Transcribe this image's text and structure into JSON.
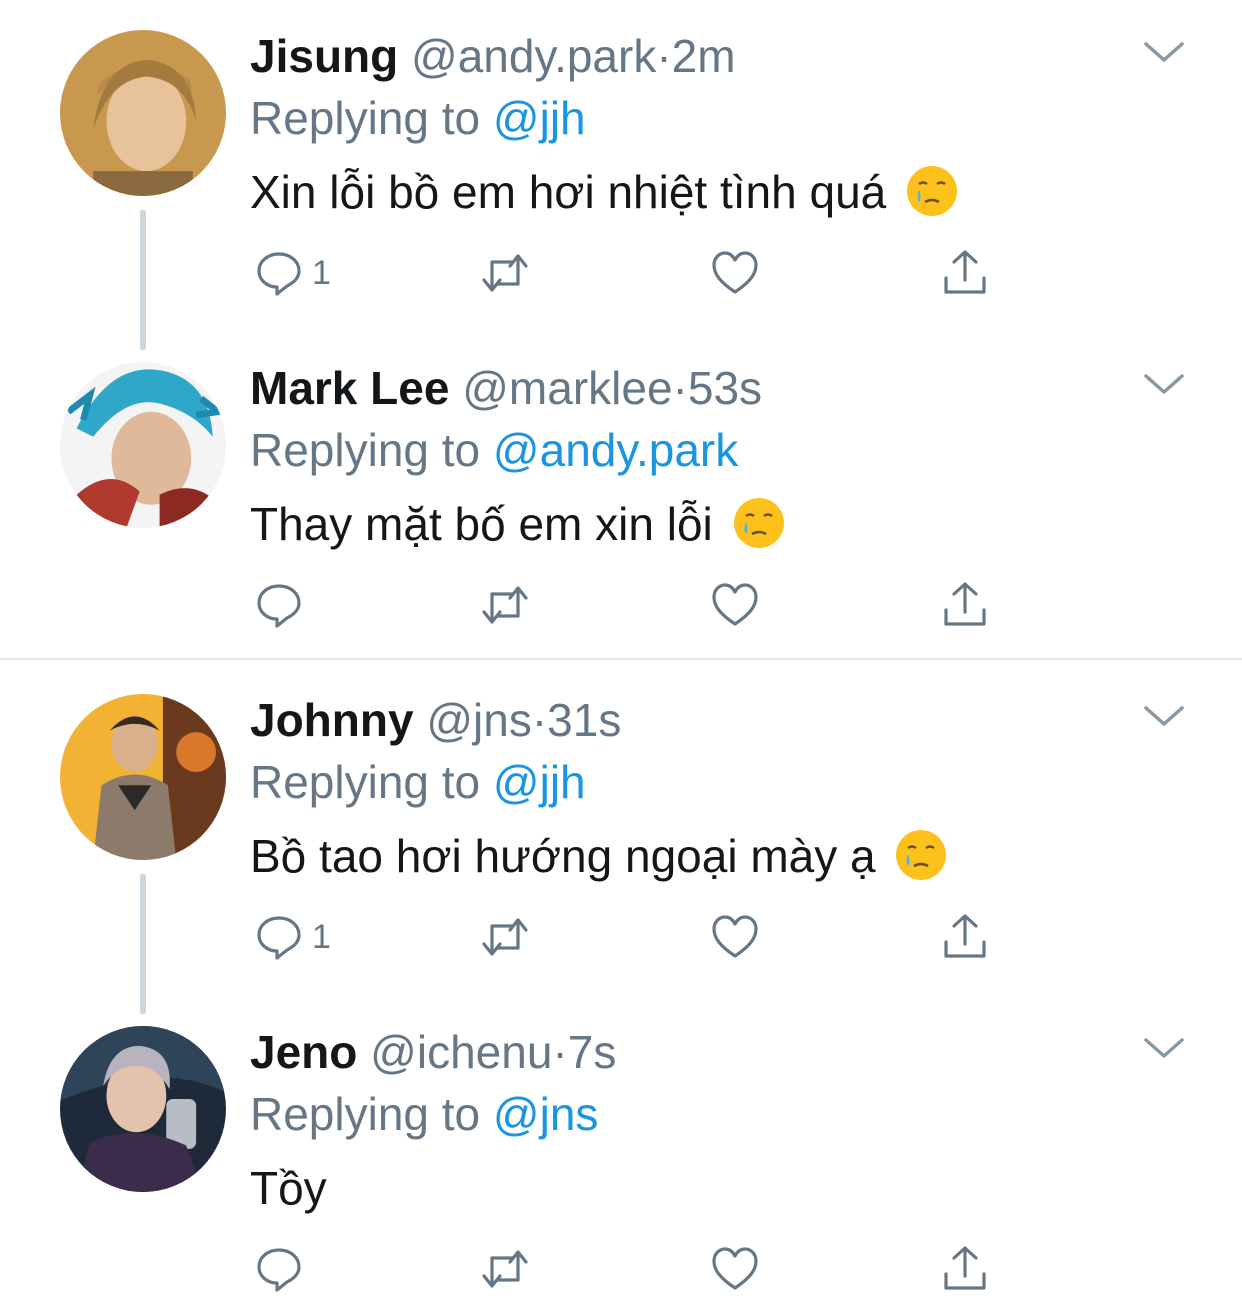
{
  "tweets": [
    {
      "name": "Jisung",
      "handle": "@andy.park",
      "sep": "·",
      "time": "2m",
      "replying_prefix": "Replying to",
      "replying_to": "@jjh",
      "text": "Xin lỗi bồ em hơi nhiệt tình quá",
      "reply_count": "1",
      "has_emoji": true
    },
    {
      "name": "Mark Lee",
      "handle": "@marklee",
      "sep": "·",
      "time": "53s",
      "replying_prefix": "Replying to",
      "replying_to": "@andy.park",
      "text": "Thay mặt bố em xin lỗi",
      "reply_count": "",
      "has_emoji": true
    },
    {
      "name": "Johnny",
      "handle": "@jns",
      "sep": "·",
      "time": "31s",
      "replying_prefix": "Replying to",
      "replying_to": "@jjh",
      "text": "Bồ tao hơi hướng ngoại mày ạ",
      "reply_count": "1",
      "has_emoji": true
    },
    {
      "name": "Jeno",
      "handle": "@ichenu",
      "sep": "·",
      "time": "7s",
      "replying_prefix": "Replying to",
      "replying_to": "@jns",
      "text": "Tồy",
      "reply_count": "",
      "has_emoji": false
    }
  ],
  "icons": {
    "reply": "reply-icon",
    "retweet": "retweet-icon",
    "like": "heart-icon",
    "share": "share-icon",
    "menu": "chevron-down-icon",
    "emoji": "face-holding-back-tears-emoji"
  },
  "colors": {
    "name": "#14171a",
    "meta": "#657786",
    "mention": "#1b95e0",
    "icon": "#657786",
    "line": "#ccd6dd"
  }
}
